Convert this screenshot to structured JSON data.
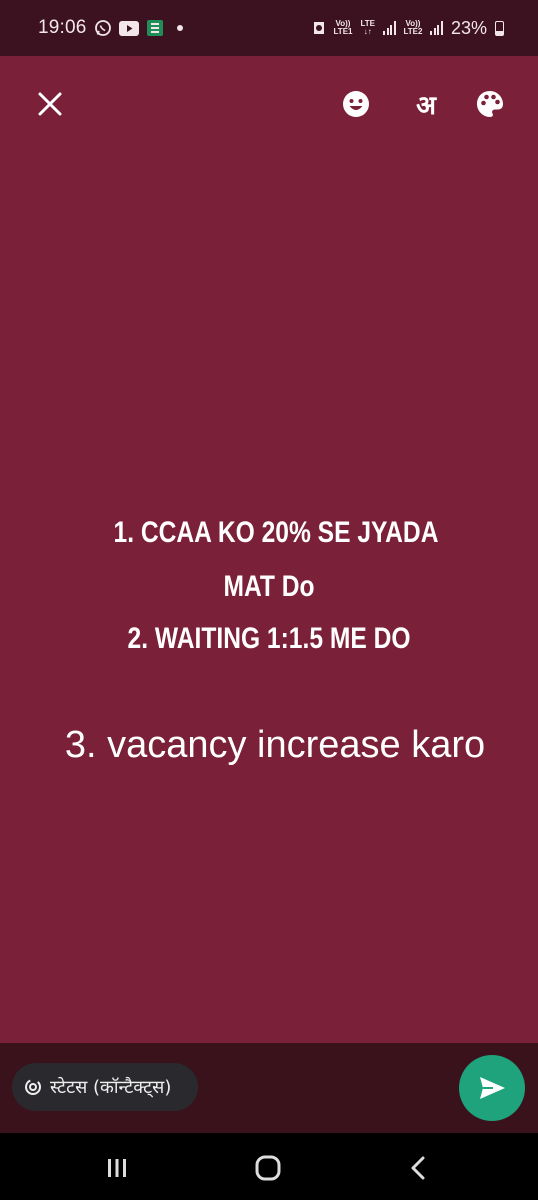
{
  "status_bar": {
    "time": "19:06",
    "sim1_label_top": "Vo))",
    "sim1_label_bottom": "LTE1",
    "net_label_top": "LTE",
    "net_label_bottom": "↓↑",
    "sim2_label_top": "Vo))",
    "sim2_label_bottom": "LTE2",
    "battery_text": "23%"
  },
  "toolbar": {
    "close_icon": "close-icon",
    "emoji_icon": "emoji-icon",
    "language_label": "अ",
    "palette_icon": "palette-icon"
  },
  "status_content": {
    "line1": "1.  CCAA KO 20% SE JYADA",
    "line2": "MAT Do",
    "line3": "2. WAITING 1:1.5  ME DO",
    "line4": "3. vacancy increase karo"
  },
  "footer": {
    "audience_label": "स्टेटस (कॉन्टैक्ट्स)",
    "send_icon": "send-icon"
  },
  "nav": {
    "recents": "recents-icon",
    "home": "home-icon",
    "back": "back-icon"
  },
  "colors": {
    "background": "#7a2038",
    "send_button": "#1ea37d"
  }
}
